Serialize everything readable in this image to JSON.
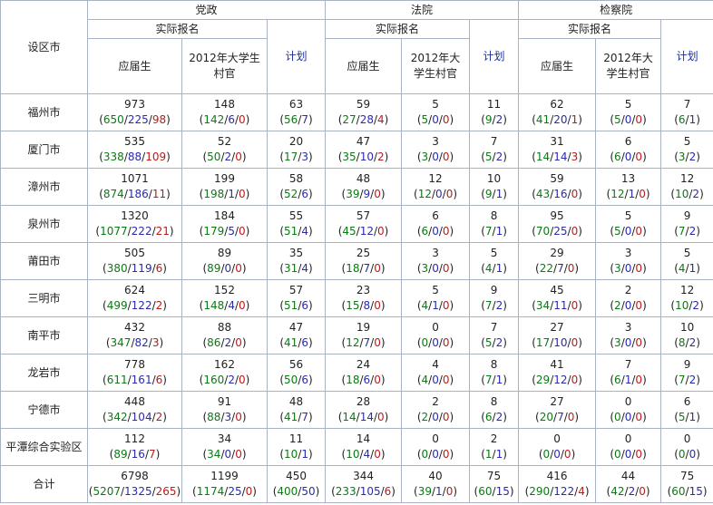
{
  "header": {
    "city_label": "设区市",
    "groups": [
      "党政",
      "法院",
      "检察院"
    ],
    "actual_label": "实际报名",
    "fresh_label": "应届生",
    "cunguan_a": "2012年大学生村官",
    "cunguan_b": "2012年大学生村官",
    "cunguan_c": "2012年大学生村官",
    "plan_label": "计划"
  },
  "rows": [
    {
      "city": "福州市",
      "cells": [
        {
          "total": "973",
          "a": "650",
          "b": "225",
          "c": "98"
        },
        {
          "total": "148",
          "a": "142",
          "b": "6",
          "c": "0"
        },
        {
          "total": "63",
          "a": "56",
          "b": "7"
        },
        {
          "total": "59",
          "a": "27",
          "b": "28",
          "c": "4"
        },
        {
          "total": "5",
          "a": "5",
          "b": "0",
          "c": "0"
        },
        {
          "total": "11",
          "a": "9",
          "b": "2"
        },
        {
          "total": "62",
          "a": "41",
          "b": "20",
          "c": "1"
        },
        {
          "total": "5",
          "a": "5",
          "b": "0",
          "c": "0"
        },
        {
          "total": "7",
          "a": "6",
          "b": "1"
        }
      ]
    },
    {
      "city": "厦门市",
      "cells": [
        {
          "total": "535",
          "a": "338",
          "b": "88",
          "c": "109"
        },
        {
          "total": "52",
          "a": "50",
          "b": "2",
          "c": "0"
        },
        {
          "total": "20",
          "a": "17",
          "b": "3"
        },
        {
          "total": "47",
          "a": "35",
          "b": "10",
          "c": "2"
        },
        {
          "total": "3",
          "a": "3",
          "b": "0",
          "c": "0"
        },
        {
          "total": "7",
          "a": "5",
          "b": "2"
        },
        {
          "total": "31",
          "a": "14",
          "b": "14",
          "c": "3"
        },
        {
          "total": "6",
          "a": "6",
          "b": "0",
          "c": "0"
        },
        {
          "total": "5",
          "a": "3",
          "b": "2"
        }
      ]
    },
    {
      "city": "漳州市",
      "cells": [
        {
          "total": "1071",
          "a": "874",
          "b": "186",
          "c": "11"
        },
        {
          "total": "199",
          "a": "198",
          "b": "1",
          "c": "0"
        },
        {
          "total": "58",
          "a": "52",
          "b": "6"
        },
        {
          "total": "48",
          "a": "39",
          "b": "9",
          "c": "0"
        },
        {
          "total": "12",
          "a": "12",
          "b": "0",
          "c": "0"
        },
        {
          "total": "10",
          "a": "9",
          "b": "1"
        },
        {
          "total": "59",
          "a": "43",
          "b": "16",
          "c": "0"
        },
        {
          "total": "13",
          "a": "12",
          "b": "1",
          "c": "0"
        },
        {
          "total": "12",
          "a": "10",
          "b": "2"
        }
      ]
    },
    {
      "city": "泉州市",
      "cells": [
        {
          "total": "1320",
          "a": "1077",
          "b": "222",
          "c": "21"
        },
        {
          "total": "184",
          "a": "179",
          "b": "5",
          "c": "0"
        },
        {
          "total": "55",
          "a": "51",
          "b": "4"
        },
        {
          "total": "57",
          "a": "45",
          "b": "12",
          "c": "0"
        },
        {
          "total": "6",
          "a": "6",
          "b": "0",
          "c": "0"
        },
        {
          "total": "8",
          "a": "7",
          "b": "1"
        },
        {
          "total": "95",
          "a": "70",
          "b": "25",
          "c": "0"
        },
        {
          "total": "5",
          "a": "5",
          "b": "0",
          "c": "0"
        },
        {
          "total": "9",
          "a": "7",
          "b": "2"
        }
      ]
    },
    {
      "city": "莆田市",
      "cells": [
        {
          "total": "505",
          "a": "380",
          "b": "119",
          "c": "6"
        },
        {
          "total": "89",
          "a": "89",
          "b": "0",
          "c": "0"
        },
        {
          "total": "35",
          "a": "31",
          "b": "4"
        },
        {
          "total": "25",
          "a": "18",
          "b": "7",
          "c": "0"
        },
        {
          "total": "3",
          "a": "3",
          "b": "0",
          "c": "0"
        },
        {
          "total": "5",
          "a": "4",
          "b": "1"
        },
        {
          "total": "29",
          "a": "22",
          "b": "7",
          "c": "0"
        },
        {
          "total": "3",
          "a": "3",
          "b": "0",
          "c": "0"
        },
        {
          "total": "5",
          "a": "4",
          "b": "1"
        }
      ]
    },
    {
      "city": "三明市",
      "cells": [
        {
          "total": "624",
          "a": "499",
          "b": "122",
          "c": "2"
        },
        {
          "total": "152",
          "a": "148",
          "b": "4",
          "c": "0"
        },
        {
          "total": "57",
          "a": "51",
          "b": "6"
        },
        {
          "total": "23",
          "a": "15",
          "b": "8",
          "c": "0"
        },
        {
          "total": "5",
          "a": "4",
          "b": "1",
          "c": "0"
        },
        {
          "total": "9",
          "a": "7",
          "b": "2"
        },
        {
          "total": "45",
          "a": "34",
          "b": "11",
          "c": "0"
        },
        {
          "total": "2",
          "a": "2",
          "b": "0",
          "c": "0"
        },
        {
          "total": "12",
          "a": "10",
          "b": "2"
        }
      ]
    },
    {
      "city": "南平市",
      "cells": [
        {
          "total": "432",
          "a": "347",
          "b": "82",
          "c": "3"
        },
        {
          "total": "88",
          "a": "86",
          "b": "2",
          "c": "0"
        },
        {
          "total": "47",
          "a": "41",
          "b": "6"
        },
        {
          "total": "19",
          "a": "12",
          "b": "7",
          "c": "0"
        },
        {
          "total": "0",
          "a": "0",
          "b": "0",
          "c": "0"
        },
        {
          "total": "7",
          "a": "5",
          "b": "2"
        },
        {
          "total": "27",
          "a": "17",
          "b": "10",
          "c": "0"
        },
        {
          "total": "3",
          "a": "3",
          "b": "0",
          "c": "0"
        },
        {
          "total": "10",
          "a": "8",
          "b": "2"
        }
      ]
    },
    {
      "city": "龙岩市",
      "cells": [
        {
          "total": "778",
          "a": "611",
          "b": "161",
          "c": "6"
        },
        {
          "total": "162",
          "a": "160",
          "b": "2",
          "c": "0"
        },
        {
          "total": "56",
          "a": "50",
          "b": "6"
        },
        {
          "total": "24",
          "a": "18",
          "b": "6",
          "c": "0"
        },
        {
          "total": "4",
          "a": "4",
          "b": "0",
          "c": "0"
        },
        {
          "total": "8",
          "a": "7",
          "b": "1"
        },
        {
          "total": "41",
          "a": "29",
          "b": "12",
          "c": "0"
        },
        {
          "total": "7",
          "a": "6",
          "b": "1",
          "c": "0"
        },
        {
          "total": "9",
          "a": "7",
          "b": "2"
        }
      ]
    },
    {
      "city": "宁德市",
      "cells": [
        {
          "total": "448",
          "a": "342",
          "b": "104",
          "c": "2"
        },
        {
          "total": "91",
          "a": "88",
          "b": "3",
          "c": "0"
        },
        {
          "total": "48",
          "a": "41",
          "b": "7"
        },
        {
          "total": "28",
          "a": "14",
          "b": "14",
          "c": "0"
        },
        {
          "total": "2",
          "a": "2",
          "b": "0",
          "c": "0"
        },
        {
          "total": "8",
          "a": "6",
          "b": "2"
        },
        {
          "total": "27",
          "a": "20",
          "b": "7",
          "c": "0"
        },
        {
          "total": "0",
          "a": "0",
          "b": "0",
          "c": "0"
        },
        {
          "total": "6",
          "a": "5",
          "b": "1"
        }
      ]
    },
    {
      "city": "平潭综合实验区",
      "cells": [
        {
          "total": "112",
          "a": "89",
          "b": "16",
          "c": "7"
        },
        {
          "total": "34",
          "a": "34",
          "b": "0",
          "c": "0"
        },
        {
          "total": "11",
          "a": "10",
          "b": "1"
        },
        {
          "total": "14",
          "a": "10",
          "b": "4",
          "c": "0"
        },
        {
          "total": "0",
          "a": "0",
          "b": "0",
          "c": "0"
        },
        {
          "total": "2",
          "a": "1",
          "b": "1"
        },
        {
          "total": "0",
          "a": "0",
          "b": "0",
          "c": "0"
        },
        {
          "total": "0",
          "a": "0",
          "b": "0",
          "c": "0"
        },
        {
          "total": "0",
          "a": "0",
          "b": "0"
        }
      ]
    },
    {
      "city": "合计",
      "cells": [
        {
          "total": "6798",
          "a": "5207",
          "b": "1325",
          "c": "265"
        },
        {
          "total": "1199",
          "a": "1174",
          "b": "25",
          "c": "0"
        },
        {
          "total": "450",
          "a": "400",
          "b": "50"
        },
        {
          "total": "344",
          "a": "233",
          "b": "105",
          "c": "6"
        },
        {
          "total": "40",
          "a": "39",
          "b": "1",
          "c": "0"
        },
        {
          "total": "75",
          "a": "60",
          "b": "15"
        },
        {
          "total": "416",
          "a": "290",
          "b": "122",
          "c": "4"
        },
        {
          "total": "44",
          "a": "42",
          "b": "2",
          "c": "0"
        },
        {
          "total": "75",
          "a": "60",
          "b": "15"
        }
      ]
    }
  ]
}
